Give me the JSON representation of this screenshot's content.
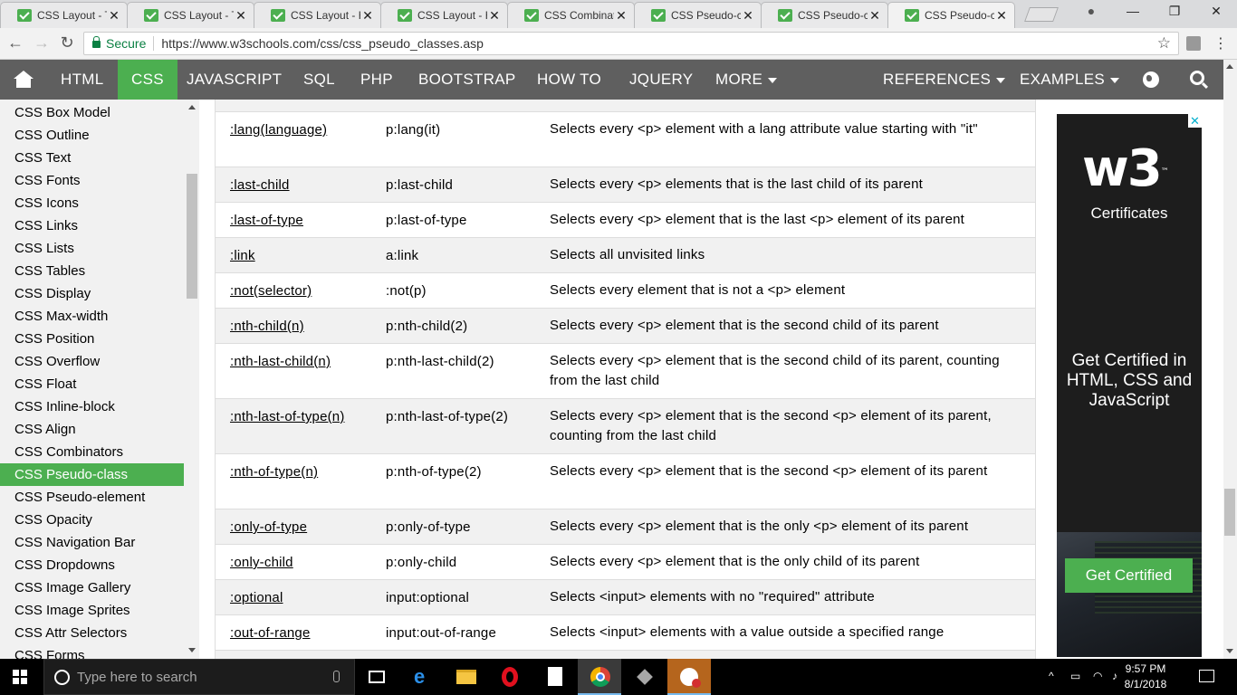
{
  "browser": {
    "tabs": [
      {
        "label": "CSS Layout - Th"
      },
      {
        "label": "CSS Layout - Th"
      },
      {
        "label": "CSS Layout - H"
      },
      {
        "label": "CSS Layout - H"
      },
      {
        "label": "CSS Combinato"
      },
      {
        "label": "CSS Pseudo-cla"
      },
      {
        "label": "CSS Pseudo-cla"
      },
      {
        "label": "CSS Pseudo-cla"
      }
    ],
    "tab_close_glyph": "✕",
    "secure_label": "Secure",
    "url": "https://www.w3schools.com/css/css_pseudo_classes.asp",
    "back_glyph": "←",
    "forward_glyph": "→",
    "reload_glyph": "↻",
    "star_glyph": "☆",
    "menu_glyph": "⋮",
    "user_glyph": "●",
    "minimize_glyph": "—",
    "restore_glyph": "❐",
    "close_glyph": "✕"
  },
  "topnav": {
    "items": [
      "HTML",
      "CSS",
      "JAVASCRIPT",
      "SQL",
      "PHP",
      "BOOTSTRAP",
      "HOW TO",
      "JQUERY",
      "MORE"
    ],
    "right_items": [
      "REFERENCES",
      "EXAMPLES"
    ],
    "active": "CSS",
    "accent_color": "#4CAF50",
    "bar_color": "#5f5f5f"
  },
  "sidebar": {
    "items": [
      "CSS Box Model",
      "CSS Outline",
      "CSS Text",
      "CSS Fonts",
      "CSS Icons",
      "CSS Links",
      "CSS Lists",
      "CSS Tables",
      "CSS Display",
      "CSS Max-width",
      "CSS Position",
      "CSS Overflow",
      "CSS Float",
      "CSS Inline-block",
      "CSS Align",
      "CSS Combinators",
      "CSS Pseudo-class",
      "CSS Pseudo-element",
      "CSS Opacity",
      "CSS Navigation Bar",
      "CSS Dropdowns",
      "CSS Image Gallery",
      "CSS Image Sprites",
      "CSS Attr Selectors",
      "CSS Forms"
    ],
    "active": "CSS Pseudo-class"
  },
  "table": {
    "rows": [
      {
        "selector": ":lang(language)",
        "example": "p:lang(it)",
        "description": "Selects every <p> element with a lang attribute value starting with \"it\""
      },
      {
        "selector": ":last-child",
        "example": "p:last-child",
        "description": "Selects every <p> elements that is the last child of its parent"
      },
      {
        "selector": ":last-of-type",
        "example": "p:last-of-type",
        "description": "Selects every <p> element that is the last <p> element of its parent"
      },
      {
        "selector": ":link",
        "example": "a:link",
        "description": "Selects all unvisited links"
      },
      {
        "selector": ":not(selector)",
        "example": ":not(p)",
        "description": "Selects every element that is not a <p> element"
      },
      {
        "selector": ":nth-child(n)",
        "example": "p:nth-child(2)",
        "description": "Selects every <p> element that is the second child of its parent"
      },
      {
        "selector": ":nth-last-child(n)",
        "example": "p:nth-last-child(2)",
        "description": "Selects every <p> element that is the second child of its parent, counting from the last child"
      },
      {
        "selector": ":nth-last-of-type(n)",
        "example": "p:nth-last-of-type(2)",
        "description": "Selects every <p> element that is the second <p> element of its parent, counting from the last child"
      },
      {
        "selector": ":nth-of-type(n)",
        "example": "p:nth-of-type(2)",
        "description": "Selects every <p> element that is the second <p> element of its parent"
      },
      {
        "selector": ":only-of-type",
        "example": "p:only-of-type",
        "description": "Selects every <p> element that is the only <p> element of its parent"
      },
      {
        "selector": ":only-child",
        "example": "p:only-child",
        "description": "Selects every <p> element that is the only child of its parent"
      },
      {
        "selector": ":optional",
        "example": "input:optional",
        "description": "Selects <input> elements with no \"required\" attribute"
      },
      {
        "selector": ":out-of-range",
        "example": "input:out-of-range",
        "description": "Selects <input> elements with a value outside a specified range"
      }
    ]
  },
  "ad": {
    "logo": "w3",
    "logo_mark": "™",
    "certificates": "Certificates",
    "headline": "Get Certified in HTML, CSS and JavaScript",
    "button": "Get Certified",
    "close_glyph": "✕"
  },
  "taskbar": {
    "search_placeholder": "Type here to search",
    "time": "9:57 PM",
    "date": "8/1/2018"
  }
}
